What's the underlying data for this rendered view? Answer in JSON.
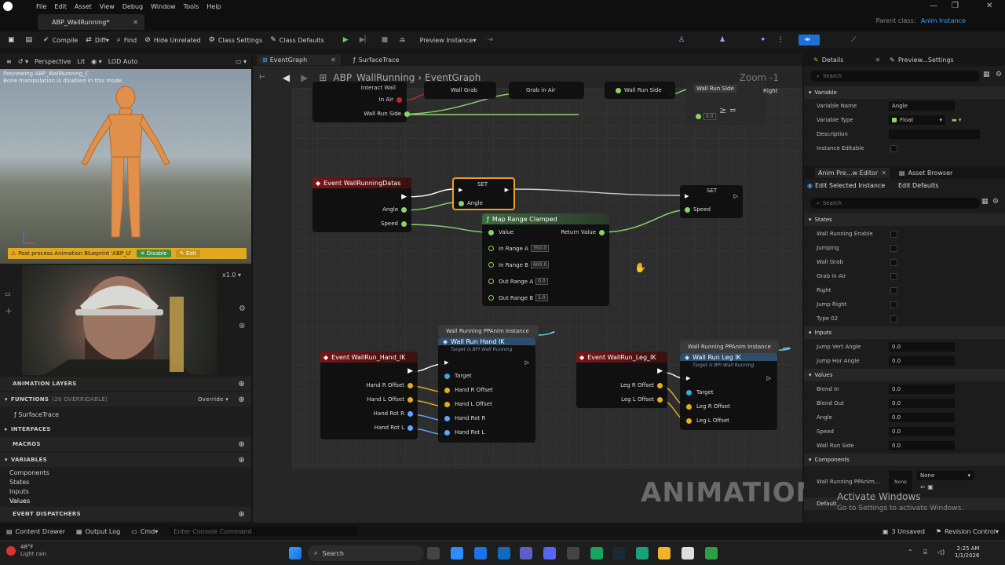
{
  "menu": [
    "File",
    "Edit",
    "Asset",
    "View",
    "Debug",
    "Window",
    "Tools",
    "Help"
  ],
  "document_tab": "ABP_WallRunning*",
  "parent_class_label": "Parent class:",
  "parent_class_value": "Anim Instance",
  "toolbar": {
    "compile": "Compile",
    "diff": "Diff",
    "find": "Find",
    "hide_unrelated": "Hide Unrelated",
    "class_settings": "Class Settings",
    "class_defaults": "Class Defaults",
    "preview_instance": "Preview Instance"
  },
  "viewport": {
    "perspective": "Perspective",
    "lit": "Lit",
    "lod": "LOD Auto",
    "note_line1": "Previewing ABP_WallRunning_C",
    "note_line2": "Bone manipulation is disabled in this mode.",
    "warning": "Post process Animation Blueprint 'ABP_U'",
    "disable": "Disable",
    "edit": "Edit",
    "speed_label": "x1.0"
  },
  "my_blueprint": {
    "animation_layers": "ANIMATION LAYERS",
    "functions": "FUNCTIONS",
    "functions_count": "(20 OVERRIDABLE)",
    "override": "Override",
    "function_item": "SurfaceTrace",
    "interfaces": "INTERFACES",
    "macros": "MACROS",
    "variables": "VARIABLES",
    "var_groups": [
      "Components",
      "States",
      "Inputs",
      "Values"
    ],
    "event_dispatchers": "EVENT DISPATCHERS"
  },
  "graph": {
    "tabs": [
      "EventGraph",
      "SurfaceTrace"
    ],
    "breadcrumb_root": "ABP_WallRunning",
    "breadcrumb_current": "EventGraph",
    "zoom": "Zoom -1",
    "top_pins": [
      "Interact Wall",
      "In Air",
      "Wall Run Side"
    ],
    "top_nodes": [
      "Wall Grab",
      "Grab in Air",
      "Wall Run Side",
      "Wall Run Side",
      "Right"
    ],
    "compare_value": "0.0",
    "event_data": "Event WallRunningDatas",
    "event_data_pins": [
      "Angle",
      "Speed"
    ],
    "set_title": "SET",
    "set1_pin": "Angle",
    "set2_pin": "Speed",
    "map_range": {
      "title": "Map Range Clamped",
      "value": "Value",
      "return": "Return Value",
      "in_a": "In Range A",
      "in_a_val": "350.0",
      "in_b": "In Range B",
      "in_b_val": "600.0",
      "out_a": "Out Range A",
      "out_a_val": "0.0",
      "out_b": "Out Range B",
      "out_b_val": "1.0"
    },
    "hand_event": "Event WallRun_Hand_IK",
    "hand_pins": [
      "Hand R Offset",
      "Hand L Offset",
      "Hand Rot R",
      "Hand Rot L"
    ],
    "pp_instance": "Wall Running PPAnim Instance",
    "hand_ik": "Wall Run Hand IK",
    "hand_ik_sub": "Target is BPI Wall Running",
    "hand_ik_pins": [
      "Target",
      "Hand R Offset",
      "Hand L Offset",
      "Hand Rot R",
      "Hand Rot L"
    ],
    "leg_event": "Event WallRun_Leg_IK",
    "leg_pins": [
      "Leg R Offset",
      "Leg L Offset"
    ],
    "leg_ik": "Wall Run Leg IK",
    "leg_ik_sub": "Target is BPI Wall Running",
    "leg_ik_pins": [
      "Target",
      "Leg R Offset",
      "Leg L Offset"
    ],
    "watermark": "ANIMATION"
  },
  "details": {
    "tab1": "Details",
    "tab2": "Preview...Settings",
    "search": "Search",
    "variable_section": "Variable",
    "variable_name_label": "Variable Name",
    "variable_name": "Angle",
    "variable_type_label": "Variable Type",
    "variable_type": "Float",
    "description_label": "Description",
    "instance_editable_label": "Instance Editable",
    "anim_tab": "Anim Pre...w Editor",
    "asset_browser": "Asset Browser",
    "edit_selected": "Edit Selected Instance",
    "edit_defaults": "Edit Defaults",
    "states_section": "States",
    "states": [
      "Wall Running Enable",
      "Jumping",
      "Wall Grab",
      "Grab in Air",
      "Right",
      "Jump Right",
      "Type 02"
    ],
    "inputs_section": "Inputs",
    "inputs": [
      {
        "label": "Jump Vert Angle",
        "value": "0.0"
      },
      {
        "label": "Jump Hor Angle",
        "value": "0.0"
      }
    ],
    "values_section": "Values",
    "values": [
      {
        "label": "Blend In",
        "value": "0.0"
      },
      {
        "label": "Blend Out",
        "value": "0.0"
      },
      {
        "label": "Angle",
        "value": "0.0"
      },
      {
        "label": "Speed",
        "value": "0.0"
      },
      {
        "label": "Wall Run Side",
        "value": "0.0"
      }
    ],
    "components_section": "Components",
    "components_item": "Wall Running PPAnim...",
    "components_none": "None",
    "components_select": "None",
    "default_label": "Default",
    "activate1": "Activate Windows",
    "activate2": "Go to Settings to activate Windows."
  },
  "statusbar": {
    "content_drawer": "Content Drawer",
    "output_log": "Output Log",
    "cmd": "Cmd",
    "console_placeholder": "Enter Console Command",
    "unsaved": "3 Unsaved",
    "revision": "Revision Control"
  },
  "taskbar": {
    "weather_temp": "48°F",
    "weather_desc": "Light rain",
    "search": "Search",
    "time": "2:25 AM",
    "date": "1/1/2026"
  }
}
